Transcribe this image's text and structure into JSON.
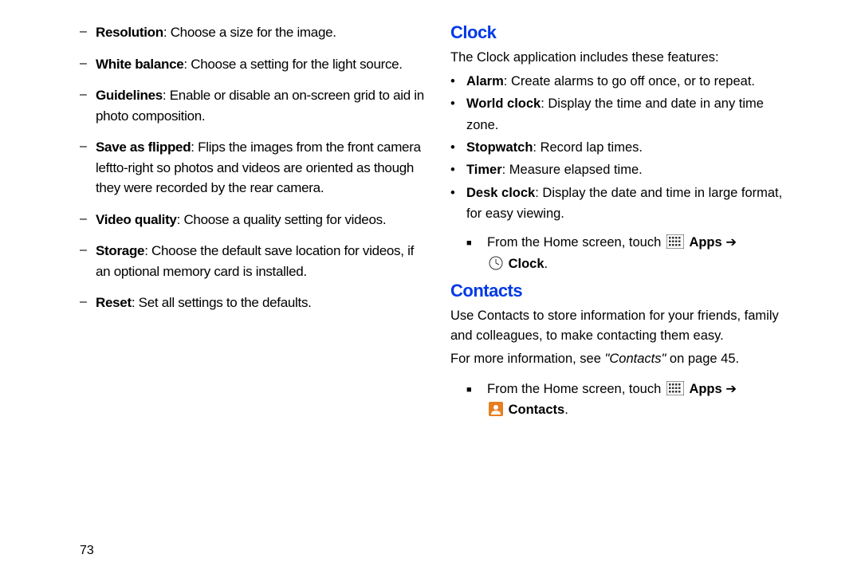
{
  "left": {
    "items": [
      {
        "term": "Resolution",
        "desc": ": Choose a size for the image."
      },
      {
        "term": "White balance",
        "desc": ": Choose a setting for the light source."
      },
      {
        "term": "Guidelines",
        "desc": ": Enable or disable an on-screen grid to aid in photo composition."
      },
      {
        "term": "Save as flipped",
        "desc": ": Flips the images from the front camera leftto-right so photos and videos are oriented as though they were recorded by the rear camera."
      },
      {
        "term": "Video quality",
        "desc": ": Choose a quality setting for videos."
      },
      {
        "term": "Storage",
        "desc": ": Choose the default save location for videos, if an optional memory card is installed."
      },
      {
        "term": "Reset",
        "desc": ": Set all settings to the defaults."
      }
    ],
    "page_number": "73"
  },
  "clock": {
    "heading": "Clock",
    "intro": "The Clock application includes these features:",
    "features": [
      {
        "term": "Alarm",
        "desc": ": Create alarms to go off once, or to repeat."
      },
      {
        "term": "World clock",
        "desc": ": Display the time and date in any time zone."
      },
      {
        "term": "Stopwatch",
        "desc": ": Record lap times."
      },
      {
        "term": "Timer",
        "desc": ": Measure elapsed time."
      },
      {
        "term": "Desk clock",
        "desc": ": Display the date and time in large format, for easy viewing."
      }
    ],
    "nav_prefix": "From the Home screen, touch ",
    "nav_apps": "Apps",
    "nav_arrow": " ➔ ",
    "nav_target": "Clock",
    "nav_period": "."
  },
  "contacts": {
    "heading": "Contacts",
    "intro": "Use Contacts to store information for your friends, family and colleagues, to make contacting them easy.",
    "see_prefix": "For more information, see ",
    "see_ref": "\"Contacts\"",
    "see_suffix": " on page 45.",
    "nav_prefix": "From the Home screen, touch ",
    "nav_apps": "Apps",
    "nav_arrow": " ➔ ",
    "nav_target": "Contacts",
    "nav_period": "."
  }
}
